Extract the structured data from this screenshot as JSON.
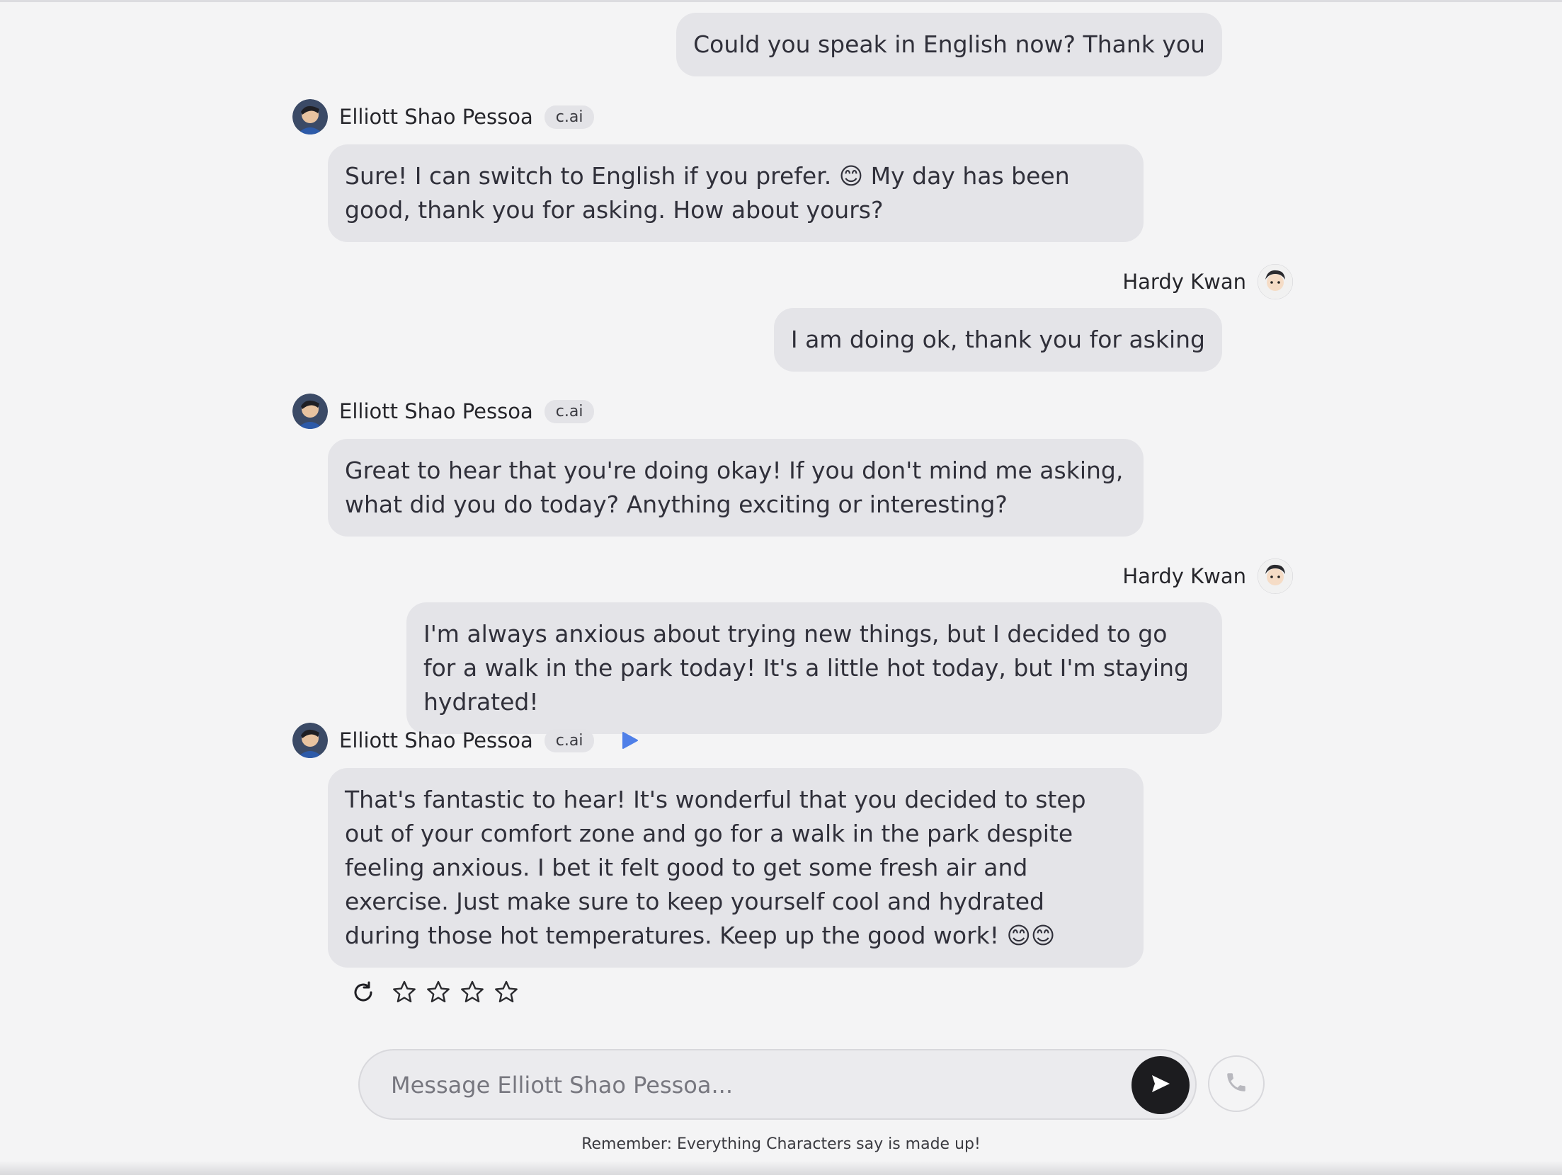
{
  "user": {
    "name": "Hardy Kwan"
  },
  "bot": {
    "name": "Elliott Shao Pessoa",
    "tag": "c.ai"
  },
  "messages": [
    {
      "role": "user",
      "text": "Could you speak in English now? Thank you"
    },
    {
      "role": "bot",
      "text": "Sure! I can switch to English if you prefer. 😊 My day has been good, thank you for asking. How about yours?"
    },
    {
      "role": "user",
      "text": "I am doing ok, thank you for asking"
    },
    {
      "role": "bot",
      "text": "Great to hear that you're doing okay! If you don't mind me asking, what did you do today? Anything exciting or interesting?"
    },
    {
      "role": "user",
      "text": "I'm always anxious about trying new things, but I decided to go for a walk in the park today! It's a little hot today, but I'm staying hydrated!"
    },
    {
      "role": "bot",
      "text": "That's fantastic to hear! It's wonderful that you decided to step out of your comfort zone and go for a walk in the park despite feeling anxious. I bet it felt good to get some fresh air and exercise. Just make sure to keep yourself cool and hydrated during those hot temperatures. Keep up the good work! 😊😊"
    }
  ],
  "rating": {
    "stars": 4,
    "filled": 0,
    "icons": [
      "reload-icon",
      "star-icon"
    ]
  },
  "composer": {
    "placeholder": "Message Elliott Shao Pessoa..."
  },
  "disclaimer": "Remember: Everything Characters say is made up!",
  "colors": {
    "accent_play": "#4f7fe8",
    "send_button": "#1c1c1f",
    "bubble": "#e4e4e8",
    "background": "#f4f4f5"
  }
}
